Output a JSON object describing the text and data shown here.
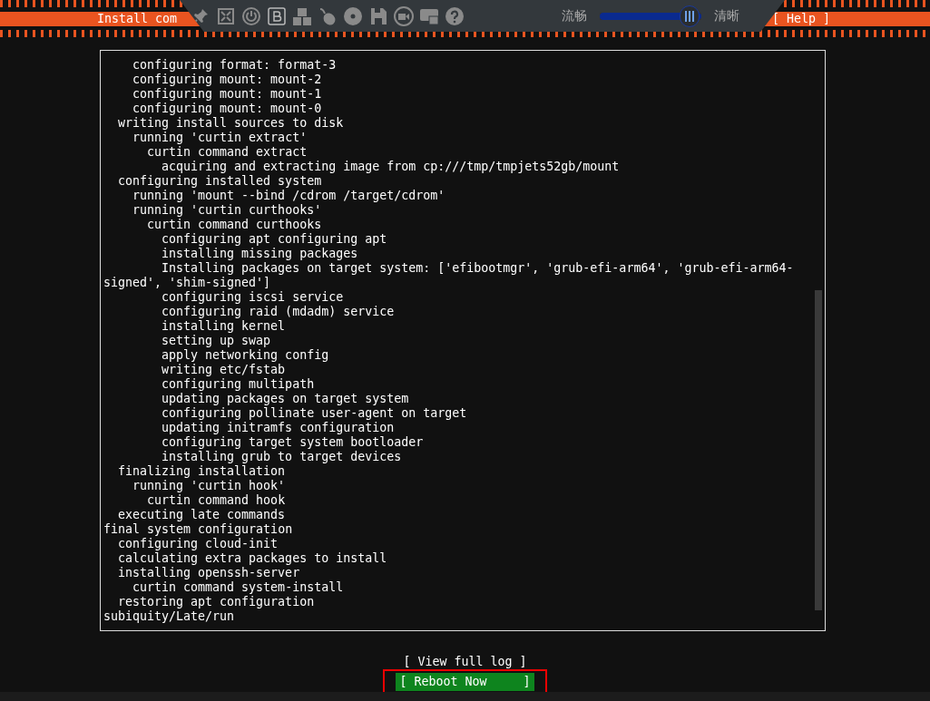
{
  "header": {
    "title": "Install com",
    "help": "[ Help ]"
  },
  "toolbar": {
    "quality_slider": {
      "left_label": "流畅",
      "right_label": "清晰",
      "level": 1.0
    }
  },
  "log": [
    {
      "children": [
        {
          "children": [
            {
              "text": "configuring format: format-3"
            },
            {
              "text": "configuring mount: mount-2"
            },
            {
              "text": "configuring mount: mount-1"
            },
            {
              "text": "configuring mount: mount-0"
            }
          ]
        }
      ]
    },
    {
      "children": [
        {
          "text": "writing install sources to disk",
          "children": [
            {
              "text": "running 'curtin extract'",
              "children": [
                {
                  "text": "curtin command extract",
                  "children": [
                    {
                      "text": "acquiring and extracting image from cp:///tmp/tmpjets52gb/mount"
                    }
                  ]
                }
              ]
            }
          ]
        },
        {
          "text": "configuring installed system",
          "children": [
            {
              "text": "running 'mount --bind /cdrom /target/cdrom'"
            },
            {
              "text": "running 'curtin curthooks'",
              "children": [
                {
                  "text": "curtin command curthooks",
                  "children": [
                    {
                      "text": "configuring apt configuring apt"
                    },
                    {
                      "text": "installing missing packages"
                    },
                    {
                      "text": "Installing packages on target system: ['efibootmgr', 'grub-efi-arm64', 'grub-efi-arm64-signed', 'shim-signed']"
                    },
                    {
                      "text": "configuring iscsi service"
                    },
                    {
                      "text": "configuring raid (mdadm) service"
                    },
                    {
                      "text": "installing kernel"
                    },
                    {
                      "text": "setting up swap"
                    },
                    {
                      "text": "apply networking config"
                    },
                    {
                      "text": "writing etc/fstab"
                    },
                    {
                      "text": "configuring multipath"
                    },
                    {
                      "text": "updating packages on target system"
                    },
                    {
                      "text": "configuring pollinate user-agent on target"
                    },
                    {
                      "text": "updating initramfs configuration"
                    },
                    {
                      "text": "configuring target system bootloader"
                    },
                    {
                      "text": "installing grub to target devices"
                    }
                  ]
                }
              ]
            }
          ]
        },
        {
          "text": "finalizing installation",
          "children": [
            {
              "text": "running 'curtin hook'",
              "children": [
                {
                  "text": "curtin command hook"
                }
              ]
            }
          ]
        },
        {
          "text": "executing late commands"
        }
      ]
    },
    {
      "text": "final system configuration",
      "children": [
        {
          "text": "configuring cloud-init"
        },
        {
          "text": "calculating extra packages to install"
        },
        {
          "text": "installing openssh-server",
          "children": [
            {
              "text": "curtin command system-install"
            }
          ]
        },
        {
          "text": "restoring apt configuration"
        }
      ]
    },
    {
      "text": "subiquity/Late/run"
    }
  ],
  "buttons": [
    {
      "label": "[ View full log ]",
      "selected": false
    },
    {
      "label": "[ Reboot Now     ]",
      "selected": true,
      "highlighted": true
    }
  ]
}
